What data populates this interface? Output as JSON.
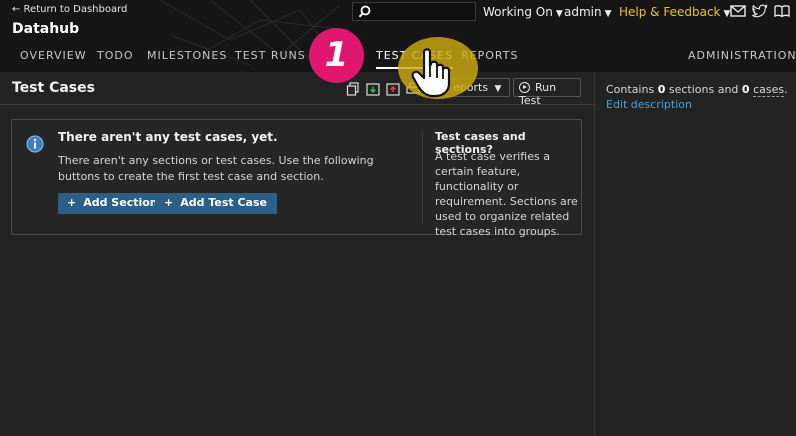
{
  "header": {
    "back_link": "← Return to Dashboard",
    "project_name": "Datahub",
    "search": {
      "placeholder": "",
      "value": ""
    },
    "working_on": "Working On",
    "user": "admin",
    "help": "Help & Feedback",
    "icons": [
      "mail-icon",
      "twitter-icon",
      "book-icon"
    ]
  },
  "tabs": [
    {
      "label": "OVERVIEW"
    },
    {
      "label": "TODO"
    },
    {
      "label": "MILESTONES"
    },
    {
      "label": "TEST RUNS & R"
    },
    {
      "label": "TEST CASES"
    },
    {
      "label": "REPORTS"
    },
    {
      "label": "ADMINISTRATION"
    }
  ],
  "page": {
    "title": "Test Cases",
    "reports_button": "eports",
    "run_test_button": "Run Test"
  },
  "empty_state": {
    "heading": "There aren't any test cases, yet.",
    "text": "There aren't any sections or test cases. Use the following buttons to create the first test case and section.",
    "add_section": "Add Section",
    "add_test_case": "Add Test Case",
    "side_heading": "Test cases and sections?",
    "side_text": "A test case verifies a certain feature, functionality or requirement. Sections are used to organize related test cases into groups."
  },
  "sidebar": {
    "prefix": "Contains ",
    "sections_count": "0",
    "sections_word": " sections and ",
    "cases_count": "0",
    "cases_word": "cases",
    "suffix": ". ",
    "edit_link": "Edit description"
  },
  "tutorial": {
    "step_number": "1"
  },
  "colors": {
    "accent_link": "#4a9fd8",
    "help_text": "#f0c020",
    "primary_button": "#2b5f86",
    "step_badge": "#e0176e",
    "highlight": "#cdaa0f"
  }
}
